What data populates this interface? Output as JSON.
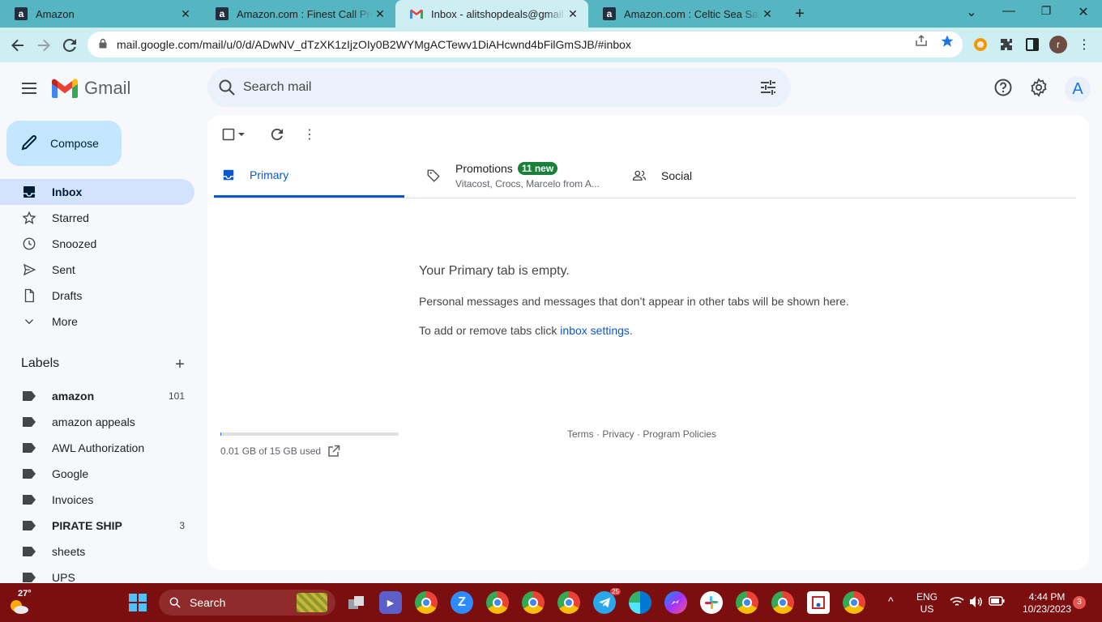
{
  "browser": {
    "tabs": [
      {
        "title": "Amazon",
        "favicon": "a",
        "active": false
      },
      {
        "title": "Amazon.com : Finest Call Premium",
        "favicon": "a",
        "active": false
      },
      {
        "title": "Inbox - alitshopdeals@gmail.com",
        "favicon": "gmail",
        "active": true
      },
      {
        "title": "Amazon.com : Celtic Sea Salt Food",
        "favicon": "a",
        "active": false
      }
    ],
    "url": "mail.google.com/mail/u/0/d/ADwNV_dTzXK1zIjzOIy0B2WYMgACTewv1DiAHcwnd4bFilGmSJB/#inbox",
    "profile_initial": "r"
  },
  "gmail": {
    "logo_text": "Gmail",
    "search_placeholder": "Search mail",
    "avatar_letter": "A",
    "compose_label": "Compose",
    "nav": [
      {
        "label": "Inbox",
        "icon": "inbox-icon",
        "selected": true
      },
      {
        "label": "Starred",
        "icon": "star-icon",
        "selected": false
      },
      {
        "label": "Snoozed",
        "icon": "clock-icon",
        "selected": false
      },
      {
        "label": "Sent",
        "icon": "send-icon",
        "selected": false
      },
      {
        "label": "Drafts",
        "icon": "draft-icon",
        "selected": false
      },
      {
        "label": "More",
        "icon": "chevron-down-icon",
        "selected": false
      }
    ],
    "labels_heading": "Labels",
    "labels": [
      {
        "label": "amazon",
        "count": "101",
        "bold": true
      },
      {
        "label": "amazon appeals",
        "count": "",
        "bold": false
      },
      {
        "label": "AWL Authorization",
        "count": "",
        "bold": false
      },
      {
        "label": "Google",
        "count": "",
        "bold": false
      },
      {
        "label": "Invoices",
        "count": "",
        "bold": false
      },
      {
        "label": "PIRATE SHIP",
        "count": "3",
        "bold": true
      },
      {
        "label": "sheets",
        "count": "",
        "bold": false
      },
      {
        "label": "UPS",
        "count": "",
        "bold": false
      }
    ],
    "inbox_tabs": {
      "primary": "Primary",
      "promotions": "Promotions",
      "promotions_badge": "11 new",
      "promotions_sub": "Vitacost, Crocs, Marcelo from A...",
      "social": "Social"
    },
    "empty": {
      "title": "Your Primary tab is empty.",
      "line1": "Personal messages and messages that don’t appear in other tabs will be shown here.",
      "line2_prefix": "To add or remove tabs click ",
      "line2_link": "inbox settings",
      "line2_suffix": "."
    },
    "storage": {
      "text": "0.01 GB of 15 GB used",
      "fraction": 0.001
    },
    "footer": {
      "terms": "Terms",
      "privacy": "Privacy",
      "policies": "Program Policies",
      "sep": " · "
    }
  },
  "taskbar": {
    "weather": "27°",
    "search_label": "Search",
    "telegram_badge": "25",
    "language": "ENG",
    "region": "US",
    "time": "4:44 PM",
    "date": "10/23/2023",
    "notifications": "3"
  },
  "colors": {
    "accent": "#0b57d0",
    "compose": "#c2e7ff",
    "nav_selected": "#d3e3fd",
    "taskbar": "#7b0e0e",
    "tabstrip": "#55b5c1"
  }
}
